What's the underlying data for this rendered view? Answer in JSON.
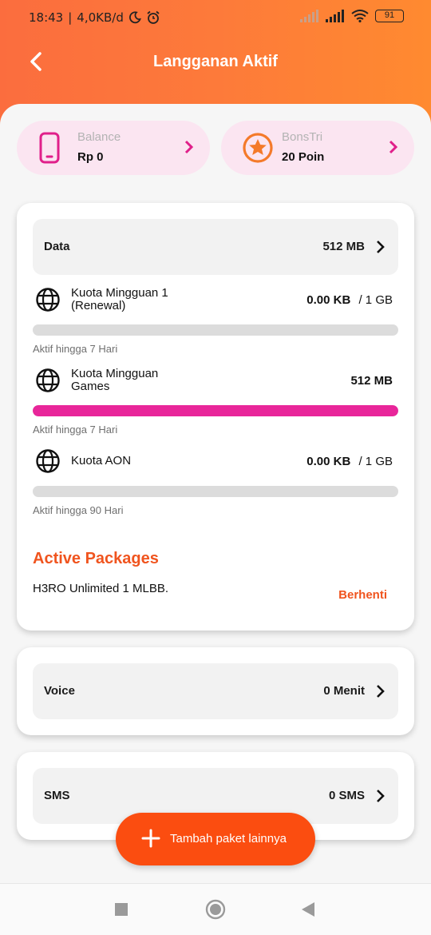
{
  "status": {
    "time": "18:43",
    "speed": "4,0KB/d",
    "battery": "91"
  },
  "header": {
    "title": "Langganan Aktif"
  },
  "balance": {
    "label": "Balance",
    "value": "Rp 0"
  },
  "bonstri": {
    "label": "BonsTri",
    "value": "20 Poin"
  },
  "data_card": {
    "label": "Data",
    "value": "512 MB",
    "quotas": [
      {
        "name_line1": "Kuota Mingguan 1",
        "name_line2": "(Renewal)",
        "used": "0.00 KB",
        "total": "/ 1 GB",
        "fill": 0,
        "validity": "Aktif hingga 7 Hari"
      },
      {
        "name_line1": "Kuota Mingguan",
        "name_line2": "Games",
        "used": "512 MB",
        "total": "",
        "fill": 1,
        "validity": "Aktif hingga 7 Hari"
      },
      {
        "name_line1": "Kuota AON",
        "name_line2": "",
        "used": "0.00 KB",
        "total": "/ 1 GB",
        "fill": 0,
        "validity": "Aktif hingga 90 Hari"
      }
    ],
    "packages_title": "Active Packages",
    "package_name": "H3RO Unlimited 1 MLBB.",
    "stop_label": "Berhenti"
  },
  "voice_card": {
    "label": "Voice",
    "value": "0 Menit"
  },
  "sms_card": {
    "label": "SMS",
    "value": "0 SMS"
  },
  "fab": {
    "label": "Tambah paket lainnya"
  },
  "colors": {
    "accent": "#f0541e",
    "magenta": "#e8269a",
    "header": "#fd7a3a"
  }
}
